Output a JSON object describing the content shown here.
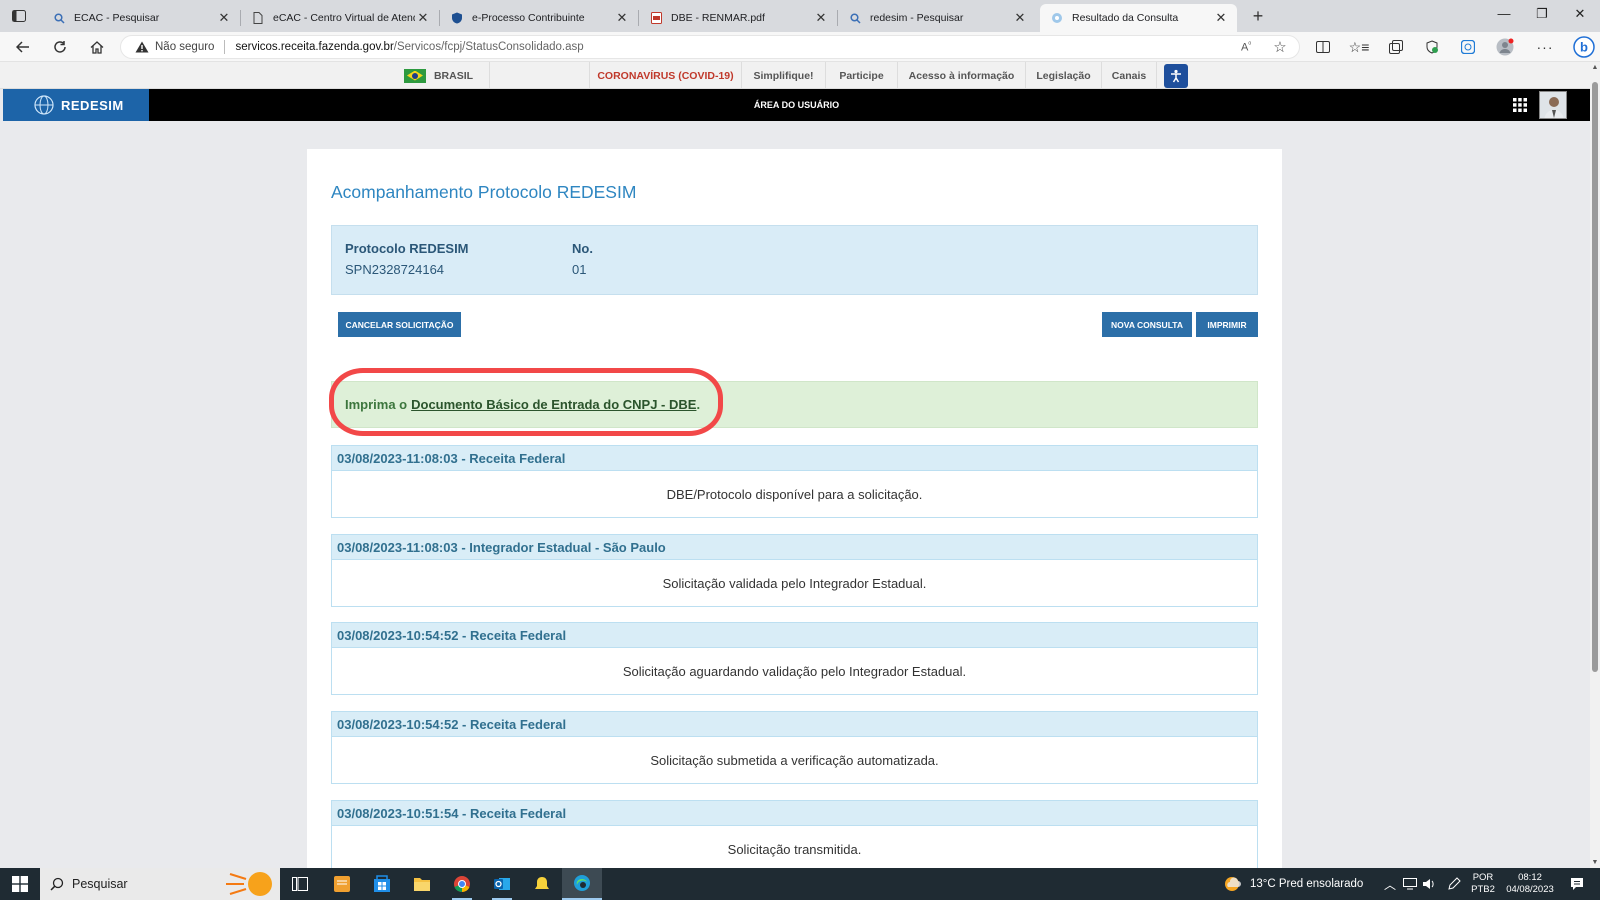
{
  "browser": {
    "tabs": [
      {
        "title": "ECAC - Pesquisar",
        "icon": "search-icon"
      },
      {
        "title": "eCAC - Centro Virtual de Atendi",
        "icon": "document-icon"
      },
      {
        "title": "e-Processo Contribuinte",
        "icon": "shield-icon"
      },
      {
        "title": "DBE - RENMAR.pdf",
        "icon": "pdf-icon"
      },
      {
        "title": "redesim - Pesquisar",
        "icon": "search-icon"
      },
      {
        "title": "Resultado da Consulta",
        "icon": "redesim-icon"
      }
    ],
    "address": {
      "security_label": "Não seguro",
      "host": "servicos.receita.fazenda.gov.br",
      "path": "/Servicos/fcpj/StatusConsolidado.asp"
    }
  },
  "govbar": {
    "country": "BRASIL",
    "links": [
      "CORONAVÍRUS (COVID-19)",
      "Simplifique!",
      "Participe",
      "Acesso à informação",
      "Legislação",
      "Canais"
    ]
  },
  "site": {
    "logo": "REDESIM",
    "area_label": "ÁREA DO USUÁRIO"
  },
  "main": {
    "title": "Acompanhamento Protocolo REDESIM",
    "protocol": {
      "label": "Protocolo REDESIM",
      "value": "SPN2328724164",
      "no_label": "No.",
      "no_value": "01"
    },
    "buttons": {
      "cancel": "CANCELAR SOLICITAÇÃO",
      "new_query": "NOVA CONSULTA",
      "print": "IMPRIMIR"
    },
    "notice": {
      "prefix": "Imprima o",
      "link": "Documento Básico de Entrada do CNPJ - DBE",
      "suffix": "."
    },
    "events": [
      {
        "header": "03/08/2023-11:08:03 - Receita Federal",
        "body": "DBE/Protocolo disponível para a solicitação."
      },
      {
        "header": "03/08/2023-11:08:03 - Integrador Estadual - São Paulo",
        "body": "Solicitação validada pelo Integrador Estadual."
      },
      {
        "header": "03/08/2023-10:54:52 - Receita Federal",
        "body": "Solicitação aguardando validação pelo Integrador Estadual."
      },
      {
        "header": "03/08/2023-10:54:52 - Receita Federal",
        "body": "Solicitação submetida a verificação automatizada."
      },
      {
        "header": "03/08/2023-10:51:54 - Receita Federal",
        "body": "Solicitação transmitida."
      }
    ]
  },
  "taskbar": {
    "search_placeholder": "Pesquisar",
    "weather": "13°C  Pred ensolarado",
    "lang_top": "POR",
    "lang_bottom": "PTB2",
    "time": "08:12",
    "date": "04/08/2023"
  },
  "colors": {
    "accent": "#2c6fa8",
    "title_blue": "#2e86c1",
    "success_bg": "#def0d8",
    "info_bg": "#d9edf7",
    "highlight": "#f24848"
  }
}
